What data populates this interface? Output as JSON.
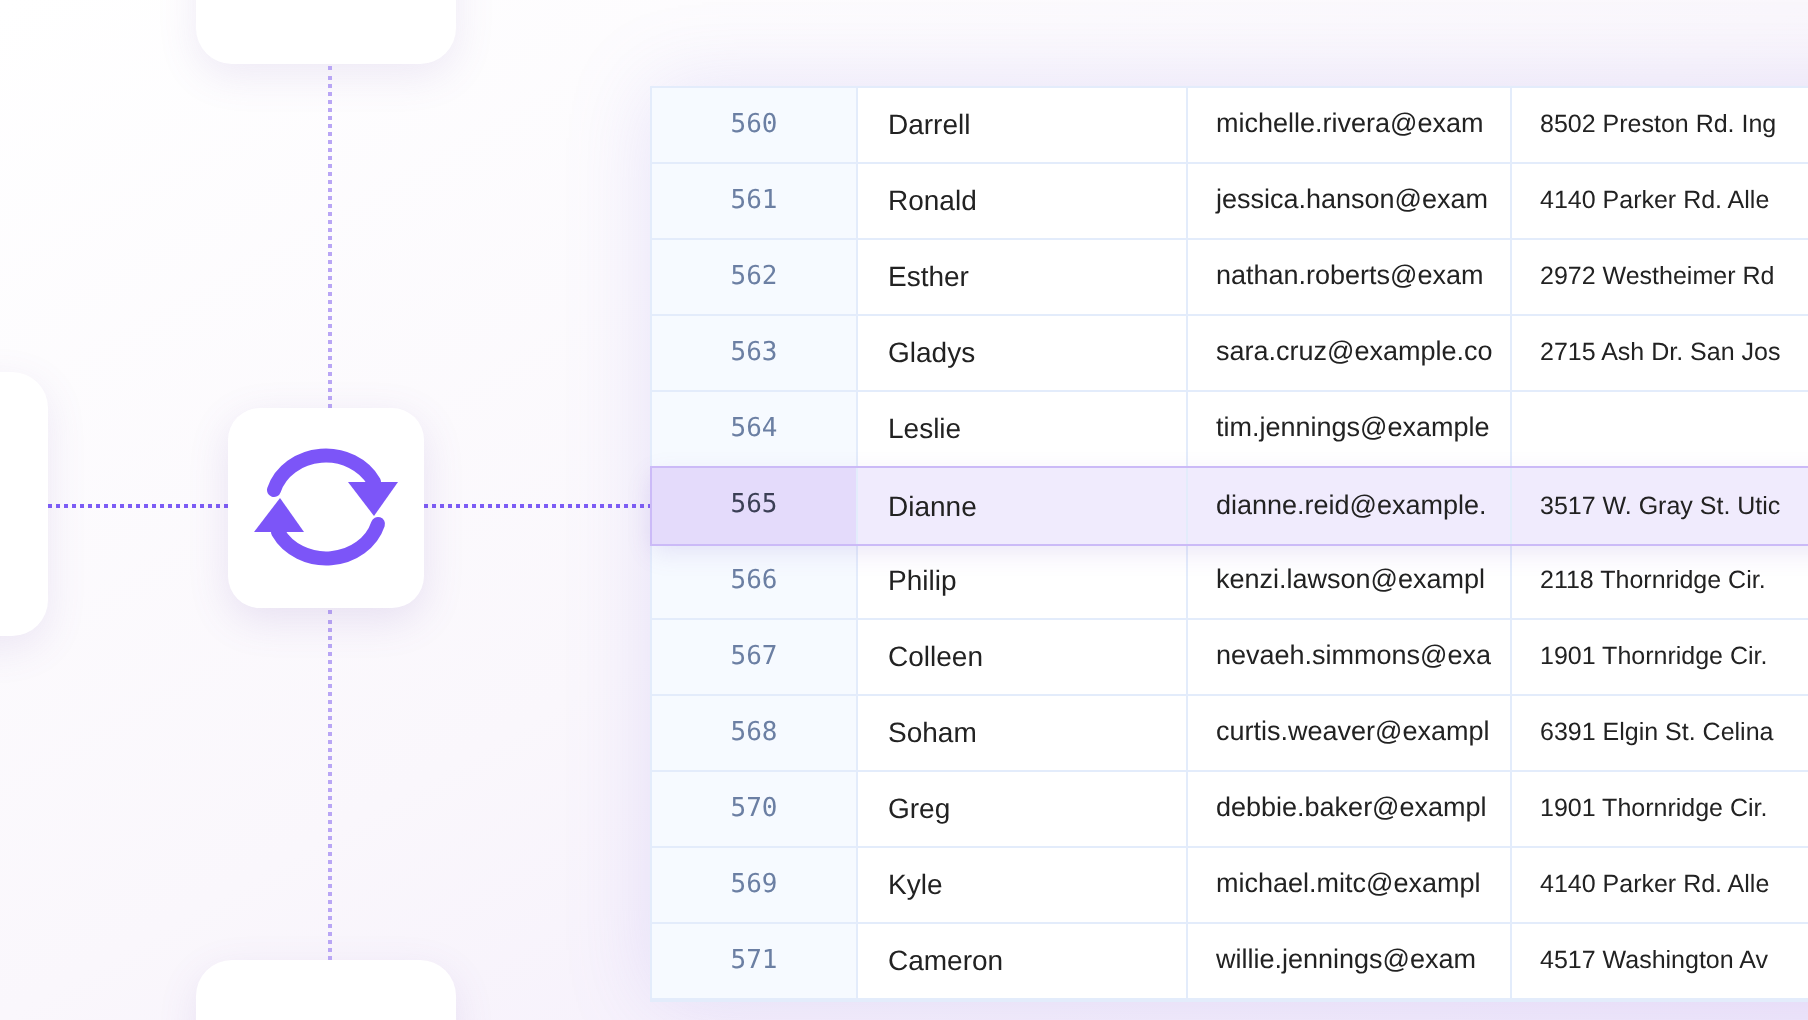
{
  "table": {
    "rows": [
      {
        "id": "560",
        "name": "Darrell",
        "email": "michelle.rivera@exam",
        "address": "8502 Preston Rd. Ing",
        "selected": false
      },
      {
        "id": "561",
        "name": "Ronald",
        "email": "jessica.hanson@exam",
        "address": "4140 Parker Rd. Alle",
        "selected": false
      },
      {
        "id": "562",
        "name": "Esther",
        "email": "nathan.roberts@exam",
        "address": "2972 Westheimer Rd",
        "selected": false
      },
      {
        "id": "563",
        "name": "Gladys",
        "email": "sara.cruz@example.co",
        "address": "2715 Ash Dr. San Jos",
        "selected": false
      },
      {
        "id": "564",
        "name": "Leslie",
        "email": "tim.jennings@example",
        "selected": false
      },
      {
        "id": "565",
        "name": "Dianne",
        "email": "dianne.reid@example.",
        "address": "3517 W. Gray St. Utic",
        "selected": true
      },
      {
        "id": "566",
        "name": "Philip",
        "email": "kenzi.lawson@exampl",
        "address": "2118 Thornridge Cir.",
        "selected": false
      },
      {
        "id": "567",
        "name": "Colleen",
        "email": "nevaeh.simmons@exa",
        "address": "1901 Thornridge Cir.",
        "selected": false
      },
      {
        "id": "568",
        "name": "Soham",
        "email": "curtis.weaver@exampl",
        "address": "6391 Elgin St. Celina",
        "selected": false
      },
      {
        "id": "570",
        "name": "Greg",
        "email": "debbie.baker@exampl",
        "address": "1901 Thornridge Cir.",
        "selected": false
      },
      {
        "id": "569",
        "name": "Kyle",
        "email": "michael.mitc@exampl",
        "address": "4140 Parker Rd. Alle",
        "selected": false
      },
      {
        "id": "571",
        "name": "Cameron",
        "email": "willie.jennings@exam",
        "address": "4517 Washington Av",
        "selected": false
      }
    ]
  }
}
